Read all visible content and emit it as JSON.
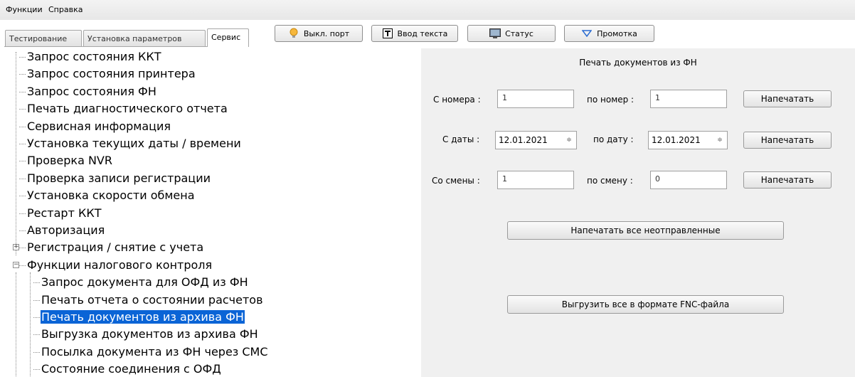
{
  "menu": [
    "Функции",
    "Справка"
  ],
  "tabs": [
    {
      "label": "Тестирование",
      "active": false
    },
    {
      "label": "Установка параметров",
      "active": false
    },
    {
      "label": "Сервис",
      "active": true
    }
  ],
  "toolbar": {
    "port_label": "Выкл. порт",
    "port_icon": "lightbulb-icon",
    "text_label": "Ввод текста",
    "text_icon": "text-t-icon",
    "status_label": "Статус",
    "status_icon": "monitor-icon",
    "feed_label": "Промотка",
    "feed_icon": "triangle-down-icon"
  },
  "tree": {
    "items": [
      {
        "label": "Запрос состояния ККТ"
      },
      {
        "label": "Запрос состояния принтера"
      },
      {
        "label": "Запрос состояния ФН"
      },
      {
        "label": "Печать диагностического отчета"
      },
      {
        "label": "Сервисная информация"
      },
      {
        "label": "Установка текущих даты / времени"
      },
      {
        "label": "Проверка NVR"
      },
      {
        "label": "Проверка записи регистрации"
      },
      {
        "label": "Установка скорости обмена"
      },
      {
        "label": "Рестарт ККТ"
      },
      {
        "label": "Авторизация"
      },
      {
        "label": "Регистрация / снятие с учета",
        "expander": "+"
      },
      {
        "label": "Функции налогового контроля",
        "expander": "−"
      }
    ],
    "children": [
      {
        "label": "Запрос документа для ОФД из ФН"
      },
      {
        "label": "Печать отчета о состоянии расчетов"
      },
      {
        "label": "Печать документов из архива ФН",
        "selected": true
      },
      {
        "label": "Выгрузка документов из архива ФН"
      },
      {
        "label": "Посылка документа из ФН через СМС"
      },
      {
        "label": "Состояние соединения с ОФД"
      }
    ]
  },
  "panel": {
    "title": "Печать документов из ФН",
    "from_number_label": "С номера :",
    "from_number_value": "1",
    "to_number_label": "по номер :",
    "to_number_value": "1",
    "from_date_label": "С даты :",
    "from_date_value": "12.01.2021",
    "to_date_label": "по дату :",
    "to_date_value": "12.01.2021",
    "from_shift_label": "Со смены :",
    "from_shift_value": "1",
    "to_shift_label": "по смену :",
    "to_shift_value": "0",
    "print_label": "Напечатать",
    "print_all_label": "Напечатать все неотправленные",
    "export_label": "Выгрузить все в формате FNC-файла",
    "spin_icon": "up-down-arrows-icon"
  },
  "colors": {
    "selection": "#0a64d6",
    "panel_bg": "#f0f0f0",
    "menubar_bg": "#ececec"
  }
}
